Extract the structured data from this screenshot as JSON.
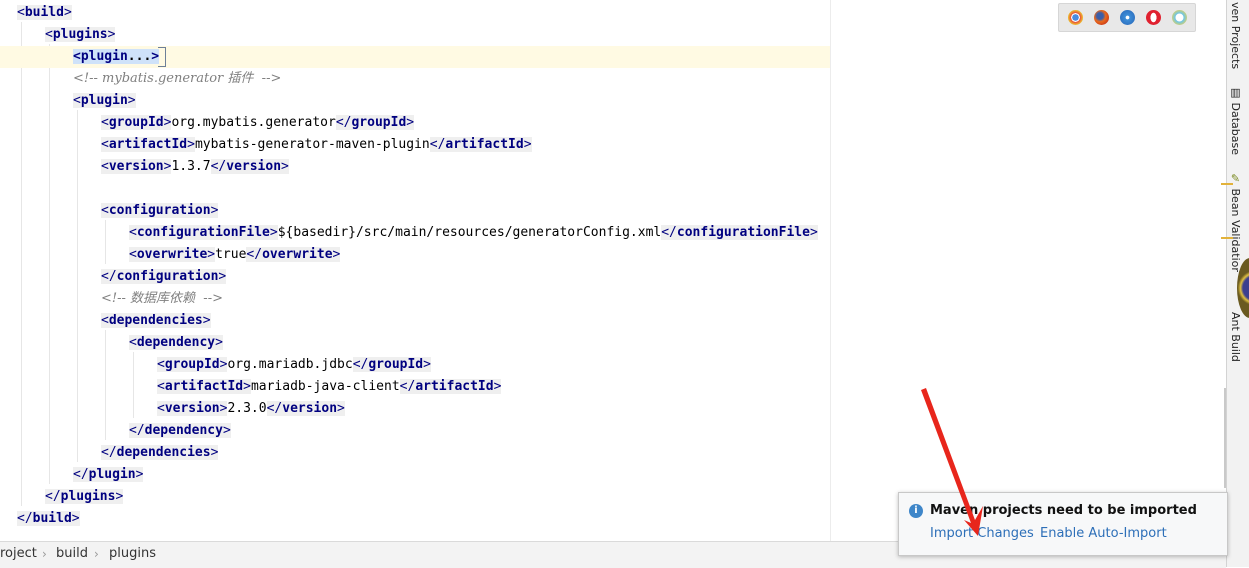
{
  "editor": {
    "lines": [
      {
        "type": "tag",
        "prefix": "",
        "name": "build",
        "suffix": ""
      },
      {
        "type": "tag",
        "prefix": "",
        "name": "plugins",
        "suffix": ""
      },
      {
        "type": "folded",
        "name": "plugin",
        "dots": "..."
      },
      {
        "type": "comment",
        "text": "<!-- mybatis.generator 插件  -->"
      },
      {
        "type": "tag",
        "prefix": "",
        "name": "plugin",
        "suffix": ""
      },
      {
        "type": "elem",
        "name": "groupId",
        "value": "org.mybatis.generator"
      },
      {
        "type": "elem",
        "name": "artifactId",
        "value": "mybatis-generator-maven-plugin"
      },
      {
        "type": "elem",
        "name": "version",
        "value": "1.3.7"
      },
      {
        "type": "blank"
      },
      {
        "type": "tag",
        "prefix": "",
        "name": "configuration",
        "suffix": ""
      },
      {
        "type": "elem",
        "name": "configurationFile",
        "value": "${basedir}/src/main/resources/generatorConfig.xml"
      },
      {
        "type": "elem",
        "name": "overwrite",
        "value": "true"
      },
      {
        "type": "tag",
        "prefix": "/",
        "name": "configuration",
        "suffix": ""
      },
      {
        "type": "comment",
        "text": "<!-- 数据库依赖  -->"
      },
      {
        "type": "tag",
        "prefix": "",
        "name": "dependencies",
        "suffix": ""
      },
      {
        "type": "tag",
        "prefix": "",
        "name": "dependency",
        "suffix": ""
      },
      {
        "type": "elem",
        "name": "groupId",
        "value": "org.mariadb.jdbc"
      },
      {
        "type": "elem",
        "name": "artifactId",
        "value": "mariadb-java-client"
      },
      {
        "type": "elem",
        "name": "version",
        "value": "2.3.0"
      },
      {
        "type": "tag",
        "prefix": "/",
        "name": "dependency",
        "suffix": ""
      },
      {
        "type": "tag",
        "prefix": "/",
        "name": "dependencies",
        "suffix": ""
      },
      {
        "type": "tag",
        "prefix": "/",
        "name": "plugin",
        "suffix": ""
      },
      {
        "type": "tag",
        "prefix": "/",
        "name": "plugins",
        "suffix": ""
      },
      {
        "type": "tag",
        "prefix": "/",
        "name": "build",
        "suffix": ""
      }
    ]
  },
  "browsers": [
    "chrome-icon",
    "firefox-icon",
    "safari-icon",
    "opera-icon",
    "ie-icon"
  ],
  "tool_windows": {
    "maven": "ven Projects",
    "database": "Database",
    "bean": "Bean Validation",
    "ant": "Ant Build"
  },
  "breadcrumb": [
    "roject",
    "build",
    "plugins"
  ],
  "notification": {
    "message": "Maven projects need to be imported",
    "import_changes": "Import Changes",
    "auto_import": "Enable Auto-Import"
  },
  "colors": {
    "tag": "#000080",
    "comment": "#808080",
    "link": "#2d6fb8",
    "annotation_arrow": "#e8261c"
  }
}
